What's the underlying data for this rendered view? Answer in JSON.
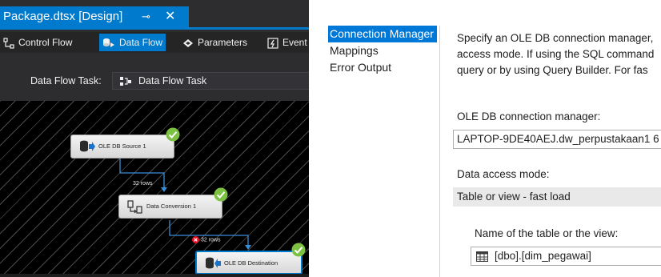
{
  "document_tab": {
    "title": "Package.dtsx [Design]",
    "pin_glyph": "⊸",
    "close_glyph": "✕"
  },
  "designer_tabs": [
    {
      "label": "Control Flow",
      "icon": "control-flow-icon"
    },
    {
      "label": "Data Flow",
      "icon": "data-flow-icon",
      "active": true
    },
    {
      "label": "Parameters",
      "icon": "parameters-icon"
    },
    {
      "label": "Event",
      "icon": "event-handlers-icon"
    }
  ],
  "task_row": {
    "label": "Data Flow Task:",
    "selected": "Data Flow Task",
    "icon": "data-flow-task-icon"
  },
  "components": [
    {
      "label": "OLE DB Source 1",
      "icon": "oledb-source-icon",
      "status": "success"
    },
    {
      "label": "Data Conversion 1",
      "icon": "data-conversion-icon",
      "status": "success"
    },
    {
      "label": "OLE DB Destination",
      "icon": "oledb-destination-icon",
      "status": "success",
      "selected": true
    }
  ],
  "paths": [
    {
      "label": "32 rows"
    },
    {
      "label": "32 rows",
      "error": true
    }
  ],
  "editor": {
    "nav": [
      "Connection Manager",
      "Mappings",
      "Error Output"
    ],
    "nav_selected": "Connection Manager",
    "description_lines": [
      "Specify an OLE DB connection manager,",
      "access mode. If using the SQL command",
      "query or by using Query Builder. For fas"
    ],
    "connection_label": "OLE DB connection manager:",
    "connection_value": "LAPTOP-9DE40AEJ.dw_perpustakaan1 6",
    "access_mode_label": "Data access mode:",
    "access_mode_value": "Table or view - fast load",
    "table_label": "Name of the table or the view:",
    "table_value": "[dbo].[dim_pegawai]",
    "table_icon": "table-icon"
  },
  "colors": {
    "accent": "#007acc",
    "nav_selected": "#0078d7",
    "success": "#7cc142",
    "error": "#e81123"
  }
}
